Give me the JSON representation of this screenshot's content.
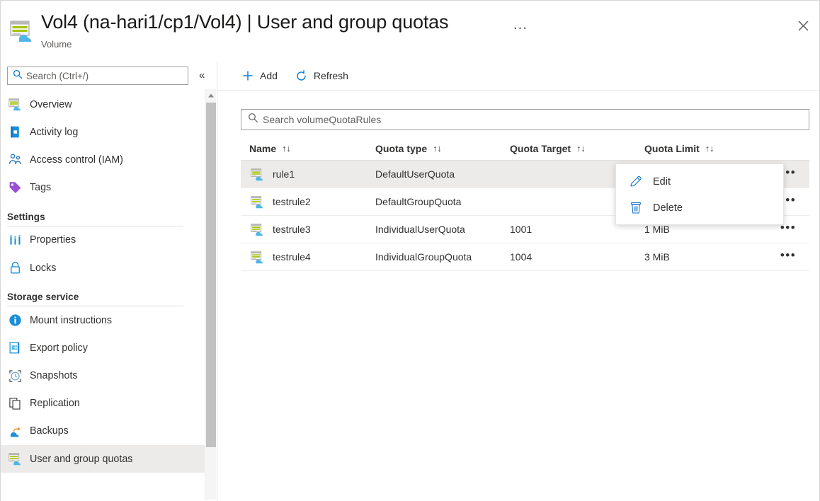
{
  "header": {
    "title": "Vol4 (na-hari1/cp1/Vol4) | User and group quotas",
    "subtitle": "Volume",
    "ellipsis": "…",
    "icon": "volume-icon",
    "close_icon": "close-icon"
  },
  "sidebar": {
    "search": {
      "placeholder": "Search (Ctrl+/)",
      "value": "",
      "icon": "search-icon"
    },
    "collapse_glyph": "«",
    "items": [
      {
        "label": "Overview",
        "icon": "volume-icon",
        "selected": false,
        "type": "item"
      },
      {
        "label": "Activity log",
        "icon": "activity-log-icon",
        "selected": false,
        "type": "item"
      },
      {
        "label": "Access control (IAM)",
        "icon": "access-control-icon",
        "selected": false,
        "type": "item"
      },
      {
        "label": "Tags",
        "icon": "tag-icon",
        "selected": false,
        "type": "item"
      },
      {
        "label": "Settings",
        "type": "group"
      },
      {
        "label": "Properties",
        "icon": "properties-icon",
        "selected": false,
        "type": "item"
      },
      {
        "label": "Locks",
        "icon": "lock-icon",
        "selected": false,
        "type": "item"
      },
      {
        "label": "Storage service",
        "type": "group"
      },
      {
        "label": "Mount instructions",
        "icon": "info-icon",
        "selected": false,
        "type": "item"
      },
      {
        "label": "Export policy",
        "icon": "export-policy-icon",
        "selected": false,
        "type": "item"
      },
      {
        "label": "Snapshots",
        "icon": "snapshot-clock-icon",
        "selected": false,
        "type": "item"
      },
      {
        "label": "Replication",
        "icon": "replication-copy-icon",
        "selected": false,
        "type": "item"
      },
      {
        "label": "Backups",
        "icon": "backup-cloud-icon",
        "selected": false,
        "type": "item"
      },
      {
        "label": "User and group quotas",
        "icon": "volume-icon",
        "selected": true,
        "type": "item"
      }
    ]
  },
  "toolbar": {
    "add_label": "Add",
    "add_icon": "plus-icon",
    "refresh_label": "Refresh",
    "refresh_icon": "refresh-icon"
  },
  "grid": {
    "search": {
      "placeholder": "Search volumeQuotaRules",
      "value": "",
      "icon": "search-icon"
    },
    "columns": [
      {
        "label": "Name",
        "sort_glyph": "↑↓"
      },
      {
        "label": "Quota type",
        "sort_glyph": "↑↓"
      },
      {
        "label": "Quota Target",
        "sort_glyph": "↑↓"
      },
      {
        "label": "Quota Limit",
        "sort_glyph": "↑↓"
      }
    ],
    "more_glyph": "•••",
    "rows": [
      {
        "name": "rule1",
        "quota_type": "DefaultUserQuota",
        "quota_target": "",
        "quota_limit": "",
        "selected": true
      },
      {
        "name": "testrule2",
        "quota_type": "DefaultGroupQuota",
        "quota_target": "",
        "quota_limit": "",
        "selected": false
      },
      {
        "name": "testrule3",
        "quota_type": "IndividualUserQuota",
        "quota_target": "1001",
        "quota_limit": "1 MiB",
        "selected": false
      },
      {
        "name": "testrule4",
        "quota_type": "IndividualGroupQuota",
        "quota_target": "1004",
        "quota_limit": "3 MiB",
        "selected": false
      }
    ]
  },
  "context_menu": {
    "items": [
      {
        "label": "Edit",
        "icon": "pencil-icon"
      },
      {
        "label": "Delete",
        "icon": "trash-icon"
      }
    ]
  },
  "colors": {
    "accent": "#0078d4",
    "selected_row": "#edebe9",
    "text": "#323130",
    "muted_text": "#605e5c",
    "border": "#e1dfdd",
    "scrollbar_thumb": "#c1c1c1"
  }
}
